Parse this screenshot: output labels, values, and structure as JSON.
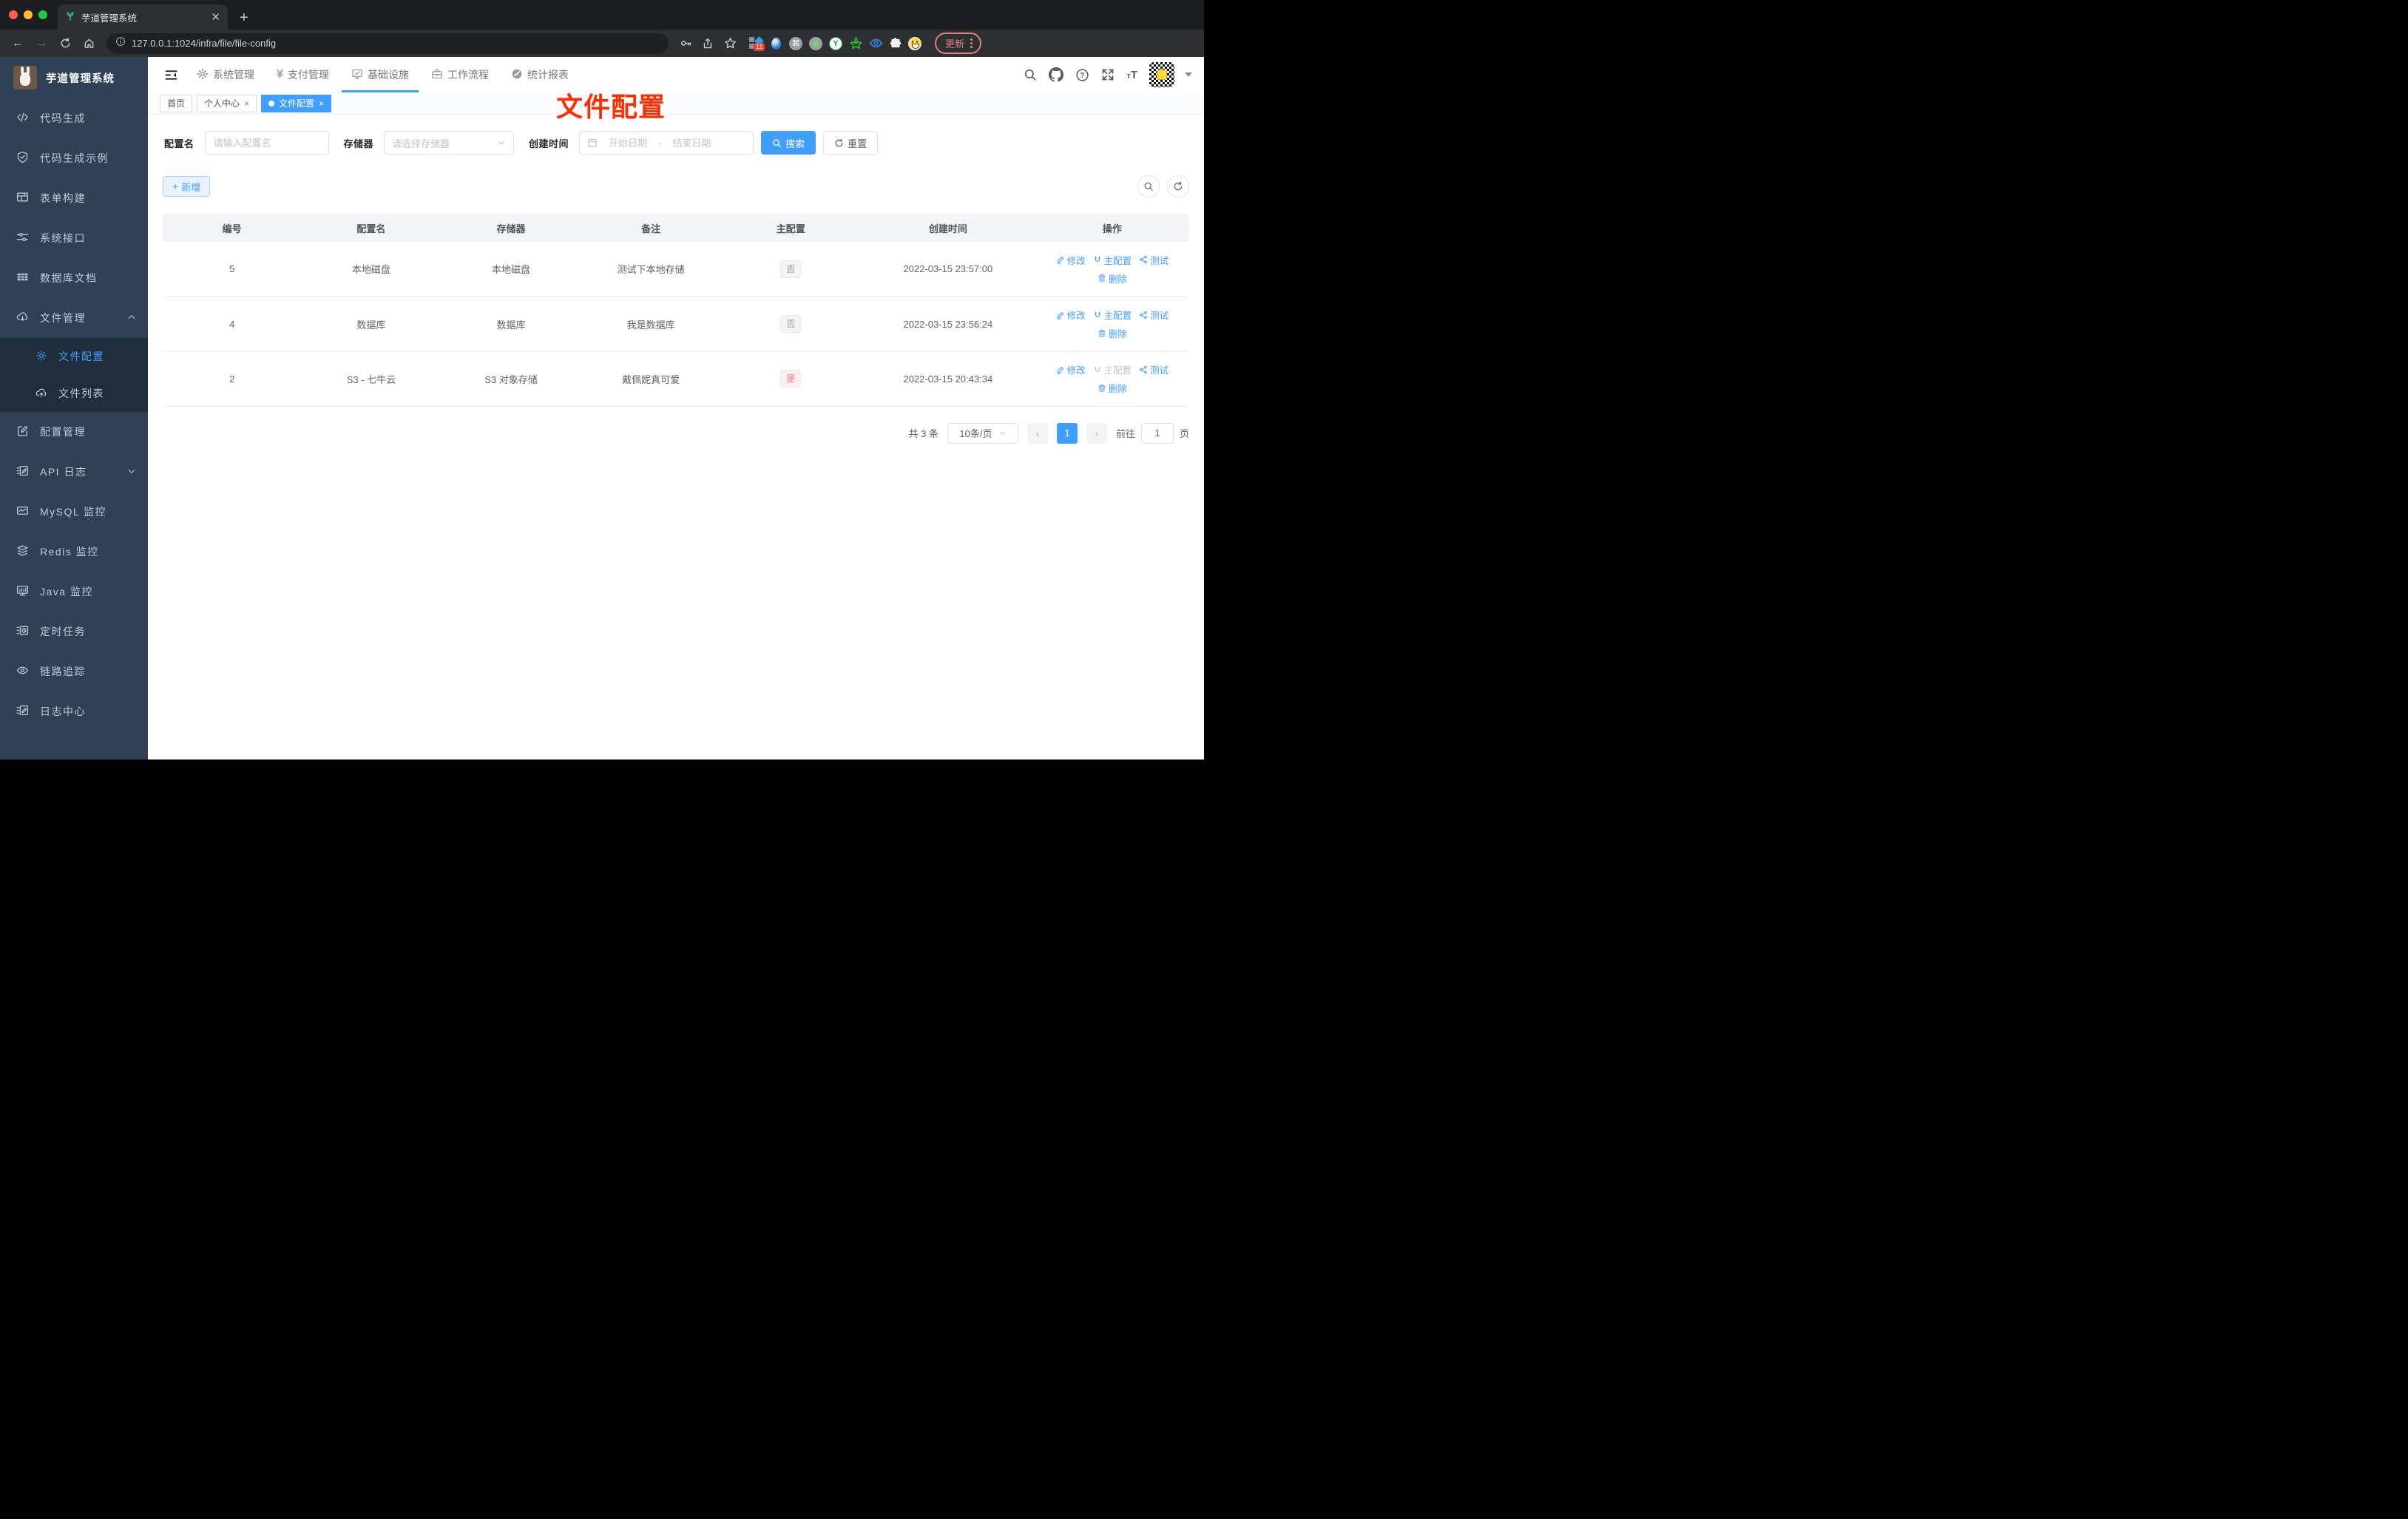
{
  "browser": {
    "tab_title": "芋道管理系统",
    "url": "127.0.0.1:1024/infra/file/file-config",
    "extensions_badge": "11",
    "update_label": "更新"
  },
  "sidebar": {
    "logo_title": "芋道管理系统",
    "items": [
      {
        "label": "代码生成"
      },
      {
        "label": "代码生成示例"
      },
      {
        "label": "表单构建"
      },
      {
        "label": "系统接口"
      },
      {
        "label": "数据库文档"
      },
      {
        "label": "文件管理"
      },
      {
        "label": "文件配置"
      },
      {
        "label": "文件列表"
      },
      {
        "label": "配置管理"
      },
      {
        "label": "API 日志"
      },
      {
        "label": "MySQL 监控"
      },
      {
        "label": "Redis 监控"
      },
      {
        "label": "Java 监控"
      },
      {
        "label": "定时任务"
      },
      {
        "label": "链路追踪"
      },
      {
        "label": "日志中心"
      }
    ]
  },
  "topnav": {
    "items": [
      {
        "label": "系统管理"
      },
      {
        "label": "支付管理"
      },
      {
        "label": "基础设施"
      },
      {
        "label": "工作流程"
      },
      {
        "label": "统计报表"
      }
    ]
  },
  "tags": {
    "items": [
      {
        "label": "首页"
      },
      {
        "label": "个人中心"
      },
      {
        "label": "文件配置"
      }
    ]
  },
  "annotation": {
    "text": "文件配置",
    "color": "#ff2d00"
  },
  "filters": {
    "name_label": "配置名",
    "name_placeholder": "请输入配置名",
    "storage_label": "存储器",
    "storage_placeholder": "请选择存储器",
    "date_label": "创建时间",
    "date_start_placeholder": "开始日期",
    "date_separator": "-",
    "date_end_placeholder": "结束日期",
    "search_label": "搜索",
    "reset_label": "重置"
  },
  "toolbar": {
    "add_label": "新增"
  },
  "table": {
    "columns": [
      "编号",
      "配置名",
      "存储器",
      "备注",
      "主配置",
      "创建时间",
      "操作"
    ],
    "action_labels": {
      "edit": "修改",
      "master": "主配置",
      "test": "测试",
      "delete": "删除"
    },
    "rows": [
      {
        "id": "5",
        "name": "本地磁盘",
        "storage": "本地磁盘",
        "remark": "测试下本地存储",
        "master": "否",
        "created": "2022-03-15 23:57:00"
      },
      {
        "id": "4",
        "name": "数据库",
        "storage": "数据库",
        "remark": "我是数据库",
        "master": "否",
        "created": "2022-03-15 23:56:24"
      },
      {
        "id": "2",
        "name": "S3 - 七牛云",
        "storage": "S3 对象存储",
        "remark": "戴佩妮真可爱",
        "master": "是",
        "created": "2022-03-15 20:43:34"
      }
    ]
  },
  "pagination": {
    "total": "共 3 条",
    "page_size": "10条/页",
    "current_page": "1",
    "goto_label": "前往",
    "goto_value": "1",
    "page_unit": "页"
  },
  "colors": {
    "primary": "#409eff",
    "danger": "#f56c6c",
    "sidebar": "#304156",
    "submenu": "#1f2d3d"
  }
}
